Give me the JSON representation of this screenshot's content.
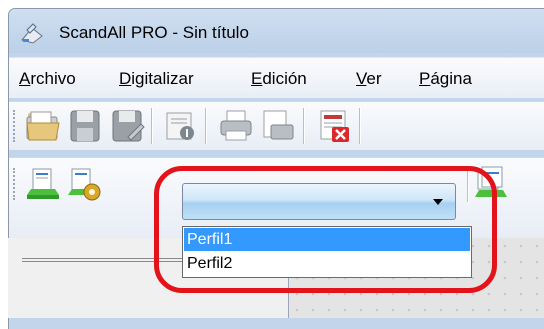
{
  "window": {
    "title": "ScandAll PRO - Sin título",
    "app_icon": "scanner-icon"
  },
  "menu": {
    "items": [
      {
        "label": "Archivo"
      },
      {
        "label": "Digitalizar"
      },
      {
        "label": "Edición"
      },
      {
        "label": "Ver"
      },
      {
        "label": "Página"
      }
    ]
  },
  "toolbar1": {
    "icons": [
      "open-folder-icon",
      "save-icon",
      "save-as-icon",
      "properties-icon",
      "print-icon",
      "print-preview-icon",
      "delete-page-icon"
    ]
  },
  "toolbar2": {
    "icons": [
      "scan-icon",
      "scan-settings-icon",
      "scan-to-folder-icon"
    ],
    "profile_combo": {
      "value": "",
      "options": [
        "Perfil1",
        "Perfil2"
      ],
      "highlighted": "Perfil1"
    }
  },
  "colors": {
    "highlight_ring": "#e3131b",
    "selection": "#3399ff",
    "title_bg": "#c3d5ea"
  }
}
